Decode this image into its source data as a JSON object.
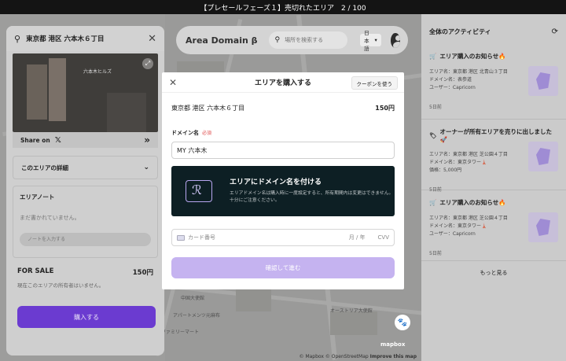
{
  "banner": {
    "text": "【プレセールフェーズ１】売切れたエリア　2 / 100"
  },
  "header": {
    "logo": "Area Domain β",
    "search_placeholder": "場所を検索する",
    "language": "日本語"
  },
  "left_panel": {
    "title": "東京都 港区 六本木６丁目",
    "image_label": "六本木ヒルズ",
    "share_label": "Share on",
    "detail_label": "このエリアの詳細",
    "note_title": "エリアノート",
    "note_empty": "まだ書かれていません。",
    "note_placeholder": "ノートを入力する",
    "sale_label": "FOR SALE",
    "sale_price": "150円",
    "sale_sub": "現在このエリアの所有者はいません。",
    "buy_button": "購入する"
  },
  "right_panel": {
    "title": "全体のアクティビティ",
    "activities": [
      {
        "title": "エリア購入のお知らせ🔥",
        "lines": [
          "エリア名：東京都 港区 北青山３丁目",
          "ドメイン名：表参道",
          "ユーザー：Capricorn"
        ],
        "date": "5日前"
      },
      {
        "title": "オーナーが所有エリアを売りに出しました🚀",
        "lines": [
          "エリア名：東京都 港区 芝公園４丁目",
          "ドメイン名：東京タワー🗼",
          "価格：5,000円"
        ],
        "date": "5日前"
      },
      {
        "title": "エリア購入のお知らせ🔥",
        "lines": [
          "エリア名：東京都 港区 芝公園４丁目",
          "ドメイン名：東京タワー🗼",
          "ユーザー：Capricorn"
        ],
        "date": "5日前"
      }
    ],
    "more": "もっと見る"
  },
  "modal": {
    "title": "エリアを購入する",
    "coupon": "クーポンを使う",
    "area": "東京都 港区 六本木６丁目",
    "price": "150円",
    "domain_label": "ドメイン名",
    "required": "必須",
    "domain_value": "MY 六本木",
    "card_title": "エリアにドメイン名を付ける",
    "card_desc": "エリアドメイン名は購入時に一度設定すると、所有期間内は変更はできません。十分にご注意ください。",
    "cc_placeholder": "カード番号",
    "cc_exp": "月 / 年",
    "cc_cvv": "CVV",
    "confirm": "確認して進む"
  },
  "map": {
    "labels": [
      "中国大使館",
      "アパートメンツ元麻布",
      "オーストリア大使館",
      "ファミリーマート"
    ],
    "attribution": "© Mapbox © OpenStreetMap",
    "improve": "Improve this map",
    "mapbox": "mapbox"
  }
}
